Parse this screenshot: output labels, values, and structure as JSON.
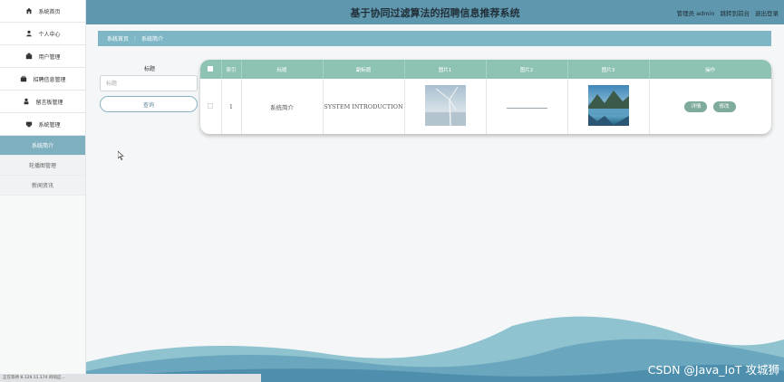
{
  "header": {
    "title": "基于协同过滤算法的招聘信息推荐系统",
    "user": "管理员 admin",
    "frontend_link": "跳转到前台",
    "logout": "退出登录"
  },
  "sidebar": {
    "items": [
      {
        "label": "系统首页",
        "icon": "home-icon"
      },
      {
        "label": "个人中心",
        "icon": "user-icon"
      },
      {
        "label": "用户管理",
        "icon": "users-icon"
      },
      {
        "label": "招聘信息管理",
        "icon": "briefcase-icon"
      },
      {
        "label": "留言板管理",
        "icon": "message-icon"
      },
      {
        "label": "系统管理",
        "icon": "gear-icon"
      }
    ],
    "subitems": [
      {
        "label": "系统简介",
        "active": true
      },
      {
        "label": "轮播图管理",
        "active": false
      },
      {
        "label": "新闻资讯",
        "active": false
      }
    ]
  },
  "breadcrumb": {
    "home": "系统首页",
    "separator": "⋮",
    "current": "系统简介"
  },
  "search": {
    "label": "标题",
    "placeholder": "标题",
    "button": "查询"
  },
  "table": {
    "headers": [
      "",
      "索引",
      "标题",
      "副标题",
      "图片1",
      "图片2",
      "图片3",
      "操作"
    ],
    "rows": [
      {
        "index": "1",
        "title": "系统简介",
        "subtitle": "SYSTEM INTRODUCTION",
        "image1": "wind-turbine-image",
        "image3": "mountain-lake-image",
        "detail_button": "详情",
        "edit_button": "修改"
      }
    ]
  },
  "status_bar": "正在等待 8.129.11.174 的响应...",
  "watermark": "CSDN @Java_IoT 攻城狮",
  "colors": {
    "header_bg": "#5f98ae",
    "table_header": "#8ec3b4",
    "active_sub": "#7fb0bf",
    "button": "#7eab9c"
  }
}
